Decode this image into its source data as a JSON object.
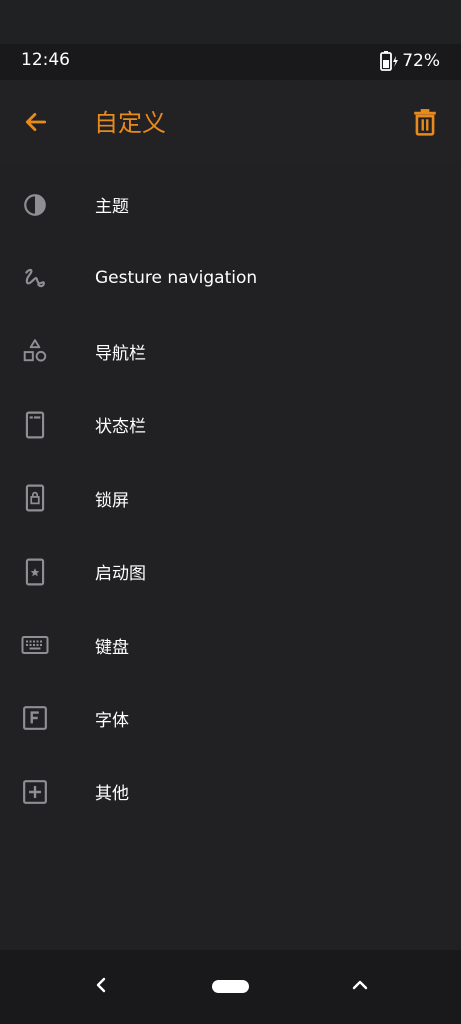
{
  "status_bar": {
    "time": "12:46",
    "battery_percent": "72%",
    "battery_icon": "battery-charging-icon"
  },
  "app_bar": {
    "title": "自定义",
    "back_icon": "arrow-left-icon",
    "delete_icon": "trash-icon"
  },
  "menu": {
    "items": [
      {
        "label": "主题",
        "icon": "theme-contrast-icon"
      },
      {
        "label": "Gesture navigation",
        "icon": "gesture-icon"
      },
      {
        "label": "导航栏",
        "icon": "shapes-icon"
      },
      {
        "label": "状态栏",
        "icon": "phone-statusbar-icon"
      },
      {
        "label": "锁屏",
        "icon": "phone-lock-icon"
      },
      {
        "label": "启动图",
        "icon": "phone-star-icon"
      },
      {
        "label": "键盘",
        "icon": "keyboard-icon"
      },
      {
        "label": "字体",
        "icon": "font-icon"
      },
      {
        "label": "其他",
        "icon": "plus-square-icon"
      }
    ]
  },
  "nav_bar": {
    "back_icon": "chevron-left-icon",
    "home_icon": "home-pill-icon",
    "recents_icon": "chevron-up-icon"
  },
  "colors": {
    "accent": "#e98a1c",
    "background": "#212123",
    "icon_gray": "#8e8e93"
  }
}
